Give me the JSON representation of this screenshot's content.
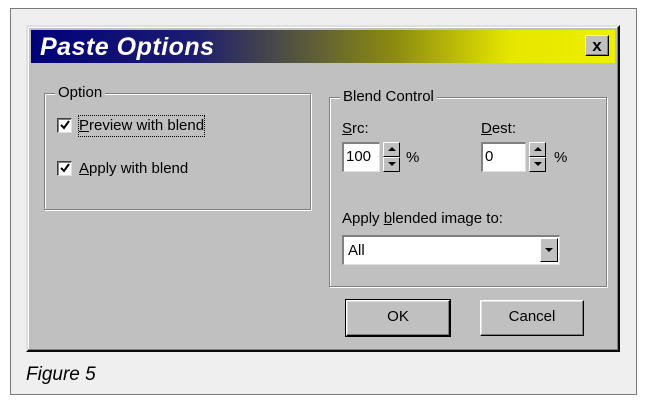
{
  "window": {
    "title": "Paste Options",
    "close_glyph": "x",
    "title_gradient": [
      "#00007a",
      "#efef00"
    ]
  },
  "option_group": {
    "legend": "Option",
    "preview": {
      "label_u": "P",
      "label_rest": "review with blend",
      "checked": true
    },
    "apply": {
      "label_u": "A",
      "label_rest": "pply with blend",
      "checked": true
    }
  },
  "blend_group": {
    "legend": "Blend Control",
    "src": {
      "label_u": "S",
      "label_rest": "rc:",
      "value": "100",
      "unit": "%"
    },
    "dest": {
      "label_u": "D",
      "label_rest": "est:",
      "value": "0",
      "unit": "%"
    },
    "apply_to": {
      "label_pre": "Apply ",
      "label_u": "b",
      "label_rest": "lended image to:",
      "selected": "All"
    }
  },
  "buttons": {
    "ok": "OK",
    "cancel": "Cancel"
  },
  "caption": "Figure 5",
  "icons": {
    "check": "checkmark-icon",
    "spin_up": "arrow-up-icon",
    "spin_down": "arrow-down-icon",
    "dropdown": "chevron-down-icon",
    "close": "close-icon"
  }
}
